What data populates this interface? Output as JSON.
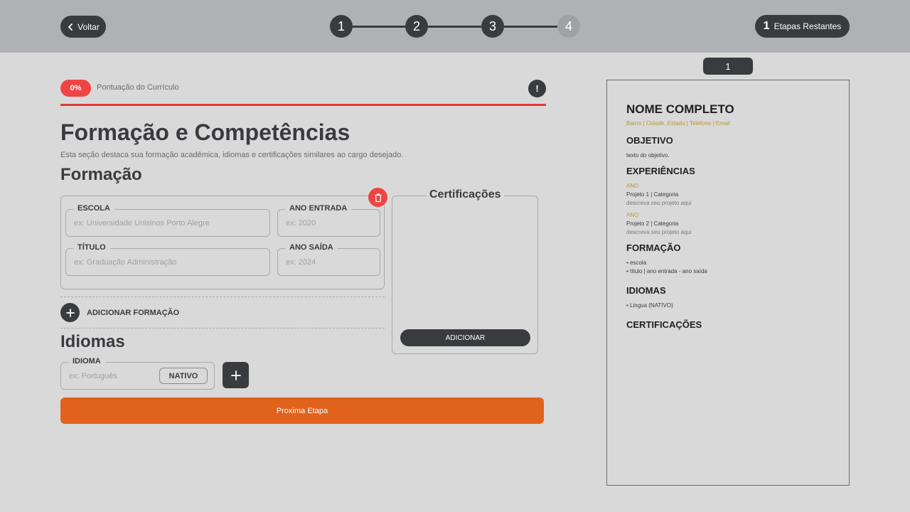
{
  "header": {
    "back_label": "Voltar",
    "steps": [
      "1",
      "2",
      "3",
      "4"
    ],
    "remaining_count": "1",
    "remaining_label": "Etapas Restantes"
  },
  "score": {
    "value": "0%",
    "label": "Pontuação do Currículo",
    "info": "!"
  },
  "page": {
    "title": "Formação e Competências",
    "description": "Esta seção destaca sua formação acadêmica, idiomas e certificações similares ao cargo desejado."
  },
  "education": {
    "title": "Formação",
    "school_label": "ESCOLA",
    "school_placeholder": "ex: Universidade Unisinos Porto Alegre",
    "entry_label": "ANO ENTRADA",
    "entry_placeholder": "ex: 2020",
    "degree_label": "TÍTULO",
    "degree_placeholder": "ex: Graduação Administração",
    "exit_label": "ANO SAÍDA",
    "exit_placeholder": "ex: 2024",
    "add_label": "ADICIONAR FORMAÇÃO"
  },
  "certifications": {
    "title": "Certificações",
    "add_label": "ADICIONAR"
  },
  "languages": {
    "title": "Idiomas",
    "field_label": "IDIOMA",
    "placeholder": "ex: Português",
    "level": "NATIVO"
  },
  "next_label": "Proxima Etapa",
  "preview": {
    "page_number": "1",
    "name": "NOME COMPLETO",
    "contact": "Bairro | Cidade, Estado | Telefone |  Email",
    "objective_title": "OBJETIVO",
    "objective_text": "texto do objetivo.",
    "experience_title": "EXPERIÊNCIAS",
    "experiences": [
      {
        "year": "ANO",
        "title": "Projeto 1 | Categoria",
        "desc": "descreva seu projeto aqui"
      },
      {
        "year": "ANO",
        "title": "Projeto 2 | Categoria",
        "desc": "descreva seu projeto aqui"
      }
    ],
    "education_title": "FORMAÇÃO",
    "education_lines": [
      "• escola",
      "• título | ano entrada - ano saída"
    ],
    "languages_title": "IDIOMAS",
    "languages_line": "• Lingua (NATIVO)",
    "certifications_title": "CERTIFICAÇÕES"
  },
  "colors": {
    "dark": "#3a3b3f",
    "accent_orange": "#e0621c",
    "danger": "#ef4444",
    "gold": "#b8962e"
  }
}
